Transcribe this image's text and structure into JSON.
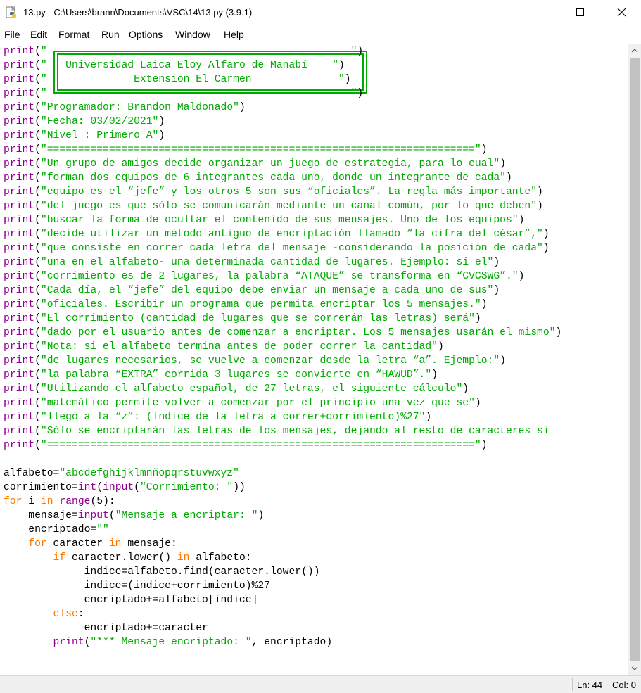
{
  "window": {
    "title": "13.py - C:\\Users\\brann\\Documents\\VSC\\14\\13.py (3.9.1)",
    "minimize_icon": "minimize-icon",
    "maximize_icon": "maximize-icon",
    "close_icon": "close-icon"
  },
  "menu": [
    "File",
    "Edit",
    "Format",
    "Run",
    "Options",
    "Window",
    "Help"
  ],
  "code_lines": [
    [
      [
        "bi",
        "print"
      ],
      [
        "",
        "("
      ],
      [
        "str",
        "\"                                                 \""
      ],
      [
        "",
        ")"
      ]
    ],
    [
      [
        "bi",
        "print"
      ],
      [
        "",
        "("
      ],
      [
        "str",
        "\"   Universidad Laica Eloy Alfaro de Manabí    \""
      ],
      [
        "",
        ")"
      ]
    ],
    [
      [
        "bi",
        "print"
      ],
      [
        "",
        "("
      ],
      [
        "str",
        "\"              Extension El Carmen              \""
      ],
      [
        "",
        ")"
      ]
    ],
    [
      [
        "bi",
        "print"
      ],
      [
        "",
        "("
      ],
      [
        "str",
        "\"                                                 \""
      ],
      [
        "",
        ")"
      ]
    ],
    [
      [
        "bi",
        "print"
      ],
      [
        "",
        "("
      ],
      [
        "str",
        "\"Programador: Brandon Maldonado\""
      ],
      [
        "",
        ")"
      ]
    ],
    [
      [
        "bi",
        "print"
      ],
      [
        "",
        "("
      ],
      [
        "str",
        "\"Fecha: 03/02/2021\""
      ],
      [
        "",
        ")"
      ]
    ],
    [
      [
        "bi",
        "print"
      ],
      [
        "",
        "("
      ],
      [
        "str",
        "\"Nivel : Primero A\""
      ],
      [
        "",
        ")"
      ]
    ],
    [
      [
        "bi",
        "print"
      ],
      [
        "",
        "("
      ],
      [
        "str",
        "\"=====================================================================\""
      ],
      [
        "",
        ")"
      ]
    ],
    [
      [
        "bi",
        "print"
      ],
      [
        "",
        "("
      ],
      [
        "str",
        "\"Un grupo de amigos decide organizar un juego de estrategia, para lo cual\""
      ],
      [
        "",
        ")"
      ]
    ],
    [
      [
        "bi",
        "print"
      ],
      [
        "",
        "("
      ],
      [
        "str",
        "\"forman dos equipos de 6 integrantes cada uno, donde un integrante de cada\""
      ],
      [
        "",
        ")"
      ]
    ],
    [
      [
        "bi",
        "print"
      ],
      [
        "",
        "("
      ],
      [
        "str",
        "\"equipo es el “jefe” y los otros 5 son sus “oficiales”. La regla más importante\""
      ],
      [
        "",
        ")"
      ]
    ],
    [
      [
        "bi",
        "print"
      ],
      [
        "",
        "("
      ],
      [
        "str",
        "\"del juego es que sólo se comunicarán mediante un canal común, por lo que deben\""
      ],
      [
        "",
        ")"
      ]
    ],
    [
      [
        "bi",
        "print"
      ],
      [
        "",
        "("
      ],
      [
        "str",
        "\"buscar la forma de ocultar el contenido de sus mensajes. Uno de los equipos\""
      ],
      [
        "",
        ")"
      ]
    ],
    [
      [
        "bi",
        "print"
      ],
      [
        "",
        "("
      ],
      [
        "str",
        "\"decide utilizar un método antiguo de encriptación llamado “la cifra del césar”,\""
      ],
      [
        "",
        ")"
      ]
    ],
    [
      [
        "bi",
        "print"
      ],
      [
        "",
        "("
      ],
      [
        "str",
        "\"que consiste en correr cada letra del mensaje -considerando la posición de cada\""
      ],
      [
        "",
        ")"
      ]
    ],
    [
      [
        "bi",
        "print"
      ],
      [
        "",
        "("
      ],
      [
        "str",
        "\"una en el alfabeto- una determinada cantidad de lugares. Ejemplo: si el\""
      ],
      [
        "",
        ")"
      ]
    ],
    [
      [
        "bi",
        "print"
      ],
      [
        "",
        "("
      ],
      [
        "str",
        "\"corrimiento es de 2 lugares, la palabra “ATAQUE” se transforma en “CVCSWG”.\""
      ],
      [
        "",
        ")"
      ]
    ],
    [
      [
        "bi",
        "print"
      ],
      [
        "",
        "("
      ],
      [
        "str",
        "\"Cada día, el “jefe” del equipo debe enviar un mensaje a cada uno de sus\""
      ],
      [
        "",
        ")"
      ]
    ],
    [
      [
        "bi",
        "print"
      ],
      [
        "",
        "("
      ],
      [
        "str",
        "\"oficiales. Escribir un programa que permita encriptar los 5 mensajes.\""
      ],
      [
        "",
        ")"
      ]
    ],
    [
      [
        "bi",
        "print"
      ],
      [
        "",
        "("
      ],
      [
        "str",
        "\"El corrimiento (cantidad de lugares que se correrán las letras) será\""
      ],
      [
        "",
        ")"
      ]
    ],
    [
      [
        "bi",
        "print"
      ],
      [
        "",
        "("
      ],
      [
        "str",
        "\"dado por el usuario antes de comenzar a encriptar. Los 5 mensajes usarán el mismo\""
      ],
      [
        "",
        ")"
      ]
    ],
    [
      [
        "bi",
        "print"
      ],
      [
        "",
        "("
      ],
      [
        "str",
        "\"Nota: si el alfabeto termina antes de poder correr la cantidad\""
      ],
      [
        "",
        ")"
      ]
    ],
    [
      [
        "bi",
        "print"
      ],
      [
        "",
        "("
      ],
      [
        "str",
        "\"de lugares necesarios, se vuelve a comenzar desde la letra “a”. Ejemplo:\""
      ],
      [
        "",
        ")"
      ]
    ],
    [
      [
        "bi",
        "print"
      ],
      [
        "",
        "("
      ],
      [
        "str",
        "\"la palabra “EXTRA” corrida 3 lugares se convierte en “HAWUD”.\""
      ],
      [
        "",
        ")"
      ]
    ],
    [
      [
        "bi",
        "print"
      ],
      [
        "",
        "("
      ],
      [
        "str",
        "\"Utilizando el alfabeto español, de 27 letras, el siguiente cálculo\""
      ],
      [
        "",
        ")"
      ]
    ],
    [
      [
        "bi",
        "print"
      ],
      [
        "",
        "("
      ],
      [
        "str",
        "\"matemático permite volver a comenzar por el principio una vez que se\""
      ],
      [
        "",
        ")"
      ]
    ],
    [
      [
        "bi",
        "print"
      ],
      [
        "",
        "("
      ],
      [
        "str",
        "\"llegó a la “z”: (índice de la letra a correr+corrimiento)%27\""
      ],
      [
        "",
        ")"
      ]
    ],
    [
      [
        "bi",
        "print"
      ],
      [
        "",
        "("
      ],
      [
        "str",
        "\"Sólo se encriptarán las letras de los mensajes, dejando al resto de caracteres si"
      ]
    ],
    [
      [
        "bi",
        "print"
      ],
      [
        "",
        "("
      ],
      [
        "str",
        "\"=====================================================================\""
      ],
      [
        "",
        ")"
      ]
    ],
    [],
    [
      [
        "",
        "alfabeto="
      ],
      [
        "str",
        "\"abcdefghijklmnñopqrstuvwxyz\""
      ]
    ],
    [
      [
        "",
        "corrimiento="
      ],
      [
        "bi",
        "int"
      ],
      [
        "",
        "("
      ],
      [
        "bi",
        "input"
      ],
      [
        "",
        "("
      ],
      [
        "str",
        "\"Corrimiento: \""
      ],
      [
        "",
        "))"
      ]
    ],
    [
      [
        "kw",
        "for"
      ],
      [
        "",
        " i "
      ],
      [
        "kw",
        "in"
      ],
      [
        "",
        " "
      ],
      [
        "bi",
        "range"
      ],
      [
        "",
        "(5):"
      ]
    ],
    [
      [
        "",
        "    mensaje="
      ],
      [
        "bi",
        "input"
      ],
      [
        "",
        "("
      ],
      [
        "str",
        "\"Mensaje a encriptar: \""
      ],
      [
        "",
        ")"
      ]
    ],
    [
      [
        "",
        "    encriptado="
      ],
      [
        "str",
        "\"\""
      ]
    ],
    [
      [
        "",
        "    "
      ],
      [
        "kw",
        "for"
      ],
      [
        "",
        " caracter "
      ],
      [
        "kw",
        "in"
      ],
      [
        "",
        " mensaje:"
      ]
    ],
    [
      [
        "",
        "        "
      ],
      [
        "kw",
        "if"
      ],
      [
        "",
        " caracter.lower() "
      ],
      [
        "kw",
        "in"
      ],
      [
        "",
        " alfabeto:"
      ]
    ],
    [
      [
        "",
        "             indice=alfabeto.find(caracter.lower())"
      ]
    ],
    [
      [
        "",
        "             indice=(indice+corrimiento)%27"
      ]
    ],
    [
      [
        "",
        "             encriptado+=alfabeto[indice]"
      ]
    ],
    [
      [
        "",
        "        "
      ],
      [
        "kw",
        "else"
      ],
      [
        "",
        ":"
      ]
    ],
    [
      [
        "",
        "             encriptado+=caracter"
      ]
    ],
    [
      [
        "",
        "        "
      ],
      [
        "bi",
        "print"
      ],
      [
        "",
        "("
      ],
      [
        "str",
        "\"*** Mensaje encriptado: \""
      ],
      [
        "",
        ", encriptado)"
      ]
    ],
    []
  ],
  "status": {
    "line": "Ln: 44",
    "col": "Col: 0"
  }
}
